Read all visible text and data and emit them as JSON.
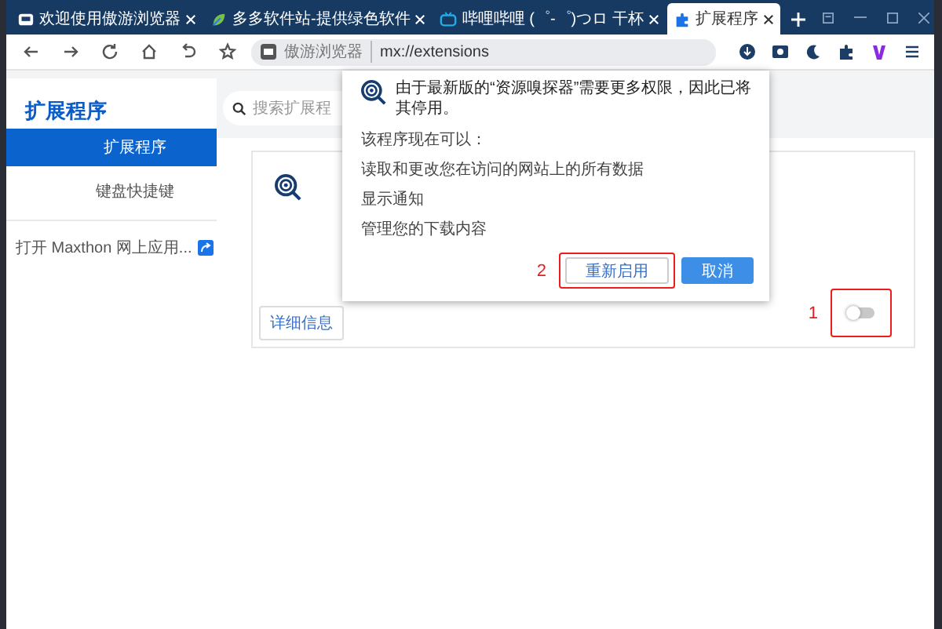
{
  "tabs": [
    {
      "title": "欢迎使用傲游浏览器",
      "selected": false
    },
    {
      "title": "多多软件站-提供绿色软件",
      "selected": false
    },
    {
      "title": "哔哩哔哩 (゜-゜)つロ 干杯",
      "selected": false
    },
    {
      "title": "扩展程序",
      "selected": true
    }
  ],
  "address": {
    "site_label": "傲游浏览器",
    "url": "mx://extensions"
  },
  "sidebar": {
    "title": "扩展程序",
    "items": [
      {
        "label": "扩展程序",
        "selected": true
      },
      {
        "label": "键盘快捷键",
        "selected": false
      }
    ],
    "link": "打开 Maxthon 网上应用..."
  },
  "search": {
    "placeholder": "搜索扩展程"
  },
  "extension": {
    "details_button": "详细信息",
    "enabled": false
  },
  "dialog": {
    "message": "由于最新版的“资源嗅探器”需要更多权限，因此已将其停用。",
    "subtitle": "该程序现在可以：",
    "permissions": [
      "读取和更改您在访问的网站上的所有数据",
      "显示通知",
      "管理您的下载内容"
    ],
    "buttons": [
      {
        "label": "重新启用",
        "kind": "secondary"
      },
      {
        "label": "取消",
        "kind": "primary"
      }
    ]
  },
  "annotations": [
    {
      "number": "1"
    },
    {
      "number": "2"
    }
  ]
}
